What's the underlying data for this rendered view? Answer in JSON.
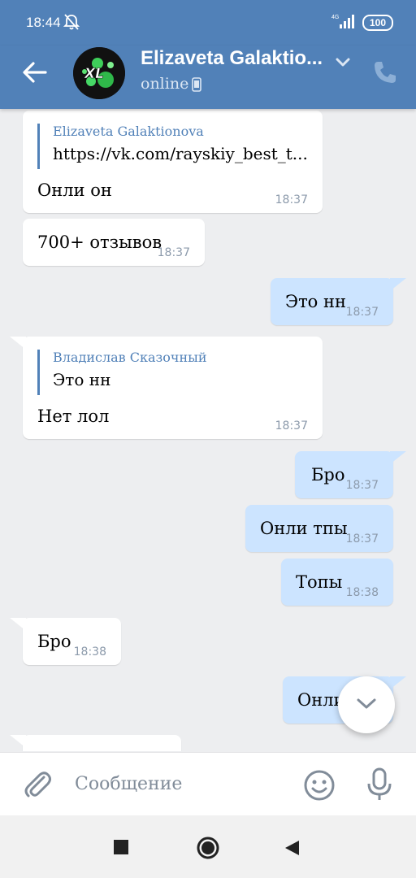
{
  "status_bar": {
    "time": "18:44",
    "network": "4G",
    "battery": "100"
  },
  "header": {
    "contact_name": "Elizaveta Galaktio...",
    "status": "online",
    "avatar_text": "XL"
  },
  "messages": [
    {
      "direction": "in",
      "reply_name": "Elizaveta Galaktionova",
      "reply_text": "https://vk.com/rayskiy_best_t...",
      "text": "Онли он",
      "time": "18:37"
    },
    {
      "direction": "in",
      "text": "700+ отзывов",
      "time": "18:37"
    },
    {
      "direction": "out",
      "text": "Это нн",
      "time": "18:37"
    },
    {
      "direction": "in",
      "reply_name": "Владислав Сказочный",
      "reply_text": "Это нн",
      "text": "Нет лол",
      "time": "18:37"
    },
    {
      "direction": "out",
      "text": "Бро",
      "time": "18:37"
    },
    {
      "direction": "out",
      "text": "Онли тпы",
      "time": "18:37"
    },
    {
      "direction": "out",
      "text": "Топы",
      "time": "18:38"
    },
    {
      "direction": "in",
      "text": "Бро",
      "time": "18:38"
    },
    {
      "direction": "out",
      "text": "Онли",
      "time": ""
    },
    {
      "direction": "in",
      "text": "",
      "time": ""
    }
  ],
  "composer": {
    "placeholder": "Сообщение"
  },
  "colors": {
    "header": "#5181b8",
    "chat_bg": "#edeef0",
    "outgoing": "#cce4ff",
    "incoming": "#ffffff"
  },
  "icons": [
    "back-arrow-icon",
    "phone-icon",
    "chevron-down-icon",
    "call-icon",
    "attach-icon",
    "emoji-icon",
    "mic-icon",
    "scroll-down-icon"
  ]
}
